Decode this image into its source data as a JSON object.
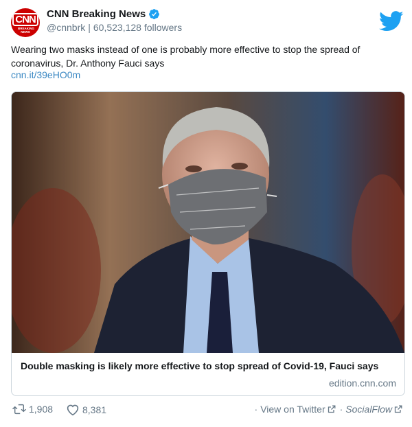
{
  "header": {
    "display_name": "CNN Breaking News",
    "handle": "@cnnbrk",
    "separator": "|",
    "followers": "60,523,128 followers",
    "avatar_text": "CNN",
    "avatar_subtext": "BREAKING NEWS"
  },
  "tweet": {
    "text": "Wearing two masks instead of one is probably more effective to stop the spread of coronavirus, Dr. Anthony Fauci says",
    "link": "cnn.it/39eHO0m"
  },
  "card": {
    "title": "Double masking is likely more effective to stop spread of Covid-19, Fauci says",
    "domain": "edition.cnn.com"
  },
  "footer": {
    "retweets": "1,908",
    "likes": "8,381",
    "view_on_twitter": "View on Twitter",
    "dot": "·",
    "source": "SocialFlow"
  },
  "colors": {
    "brand_red": "#cc0000",
    "twitter_blue": "#1da1f2",
    "link_blue": "#3b88c3",
    "muted": "#657786"
  }
}
